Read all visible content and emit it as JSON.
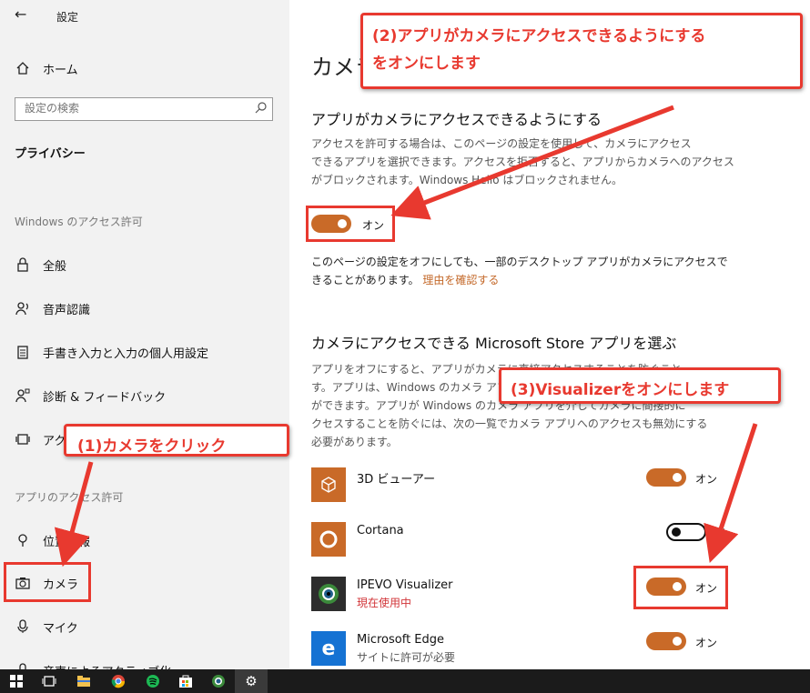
{
  "window": {
    "title": "設定"
  },
  "sidebar": {
    "home": "ホーム",
    "search_placeholder": "設定の検索",
    "section": "プライバシー",
    "group_windows": "Windows のアクセス許可",
    "group_app": "アプリのアクセス許可",
    "items": [
      {
        "label": "全般",
        "icon": "lock-icon"
      },
      {
        "label": "音声認識",
        "icon": "speech-icon"
      },
      {
        "label": "手書き入力と入力の個人用設定",
        "icon": "clipboard-icon"
      },
      {
        "label": "診断 & フィードバック",
        "icon": "feedback-icon"
      },
      {
        "label": "アク",
        "icon": "activity-icon"
      },
      {
        "label": "位置情報",
        "icon": "location-icon"
      },
      {
        "label": "カメラ",
        "icon": "camera-icon"
      },
      {
        "label": "マイク",
        "icon": "microphone-icon"
      },
      {
        "label": "音声によるアクティブ化",
        "icon": "voice-icon"
      }
    ]
  },
  "main": {
    "page_title": "カメラ",
    "section1_title": "アプリがカメラにアクセスできるようにする",
    "section1_desc": [
      "アクセスを許可する場合は、このページの設定を使用して、カメラにアクセス",
      "できるアプリを選択できます。アクセスを拒否すると、アプリからカメラへのアクセス",
      "がブロックされます。Windows Hello はブロックされません。"
    ],
    "master_toggle_label": "オン",
    "master_toggle_state": "on",
    "note_line1": "このページの設定をオフにしても、一部のデスクトップ アプリがカメラにアクセスで",
    "note_line2": "きることがあります。",
    "note_link": "理由を確認する",
    "section2_title": "カメラにアクセスできる Microsoft Store アプリを選ぶ",
    "section2_desc": [
      "アプリをオフにすると、アプリがカメラに直接アクセスすることを防ぐこと",
      "す。アプリは、Windows のカメラ アプリを介してカメラに間接的にアクセス",
      "ができます。アプリが Windows のカメラ アプリを介してカメラに間接的に",
      "クセスすることを防ぐには、次の一覧でカメラ アプリへのアクセスも無効にする",
      "必要があります。"
    ],
    "apps": [
      {
        "name": "3D ビューアー",
        "sub": "",
        "toggle": "on",
        "toggle_label": "オン",
        "icon": "cube-icon",
        "icon_bg": "#c96a28"
      },
      {
        "name": "Cortana",
        "sub": "",
        "toggle": "off",
        "toggle_label": "オ",
        "icon": "circle-icon",
        "icon_bg": "#c96a28"
      },
      {
        "name": "IPEVO Visualizer",
        "sub": "現在使用中",
        "toggle": "on",
        "toggle_label": "オン",
        "icon": "ipevo-icon",
        "icon_bg": "#2d2d2d"
      },
      {
        "name": "Microsoft Edge",
        "sub": "サイトに許可が必要",
        "toggle": "on",
        "toggle_label": "オン",
        "icon": "edge-icon",
        "icon_bg": "#1572d3"
      }
    ]
  },
  "annotations": {
    "step1": "(1)カメラをクリック",
    "step2_line1": "(2)アプリがカメラにアクセスできるようにする",
    "step2_line2": "をオンにします",
    "step3": "(3)Visualizerをオンにします"
  },
  "colors": {
    "accent": "#c96a28",
    "annotation": "#e8392f",
    "in_use": "#d13438"
  },
  "taskbar": [
    "windows-start-icon",
    "task-view-icon",
    "file-explorer-icon",
    "chrome-icon",
    "spotify-icon",
    "store-icon",
    "ipevo-taskbar-icon",
    "settings-taskbar-icon"
  ]
}
